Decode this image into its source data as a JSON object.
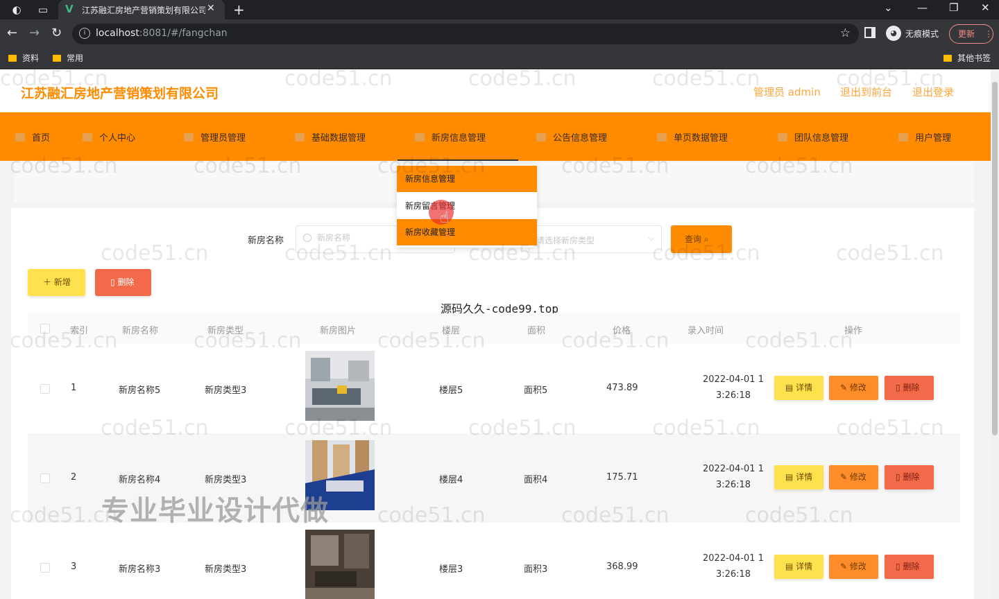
{
  "browser": {
    "tab_title": "江苏融汇房地产营销策划有限公司",
    "url_host": "localhost",
    "url_path": ":8081/#/fangchan",
    "incognito_label": "无痕模式",
    "update_label": "更新",
    "bookmarks": [
      "资料",
      "常用"
    ],
    "other_bookmarks": "其他书签"
  },
  "header": {
    "title": "江苏融汇房地产营销策划有限公司",
    "admin_label": "管理员 admin",
    "frontend_link": "退出到前台",
    "logout_link": "退出登录"
  },
  "nav": {
    "items": [
      {
        "label": "首页"
      },
      {
        "label": "个人中心"
      },
      {
        "label": "管理员管理"
      },
      {
        "label": "基础数据管理"
      },
      {
        "label": "新房信息管理"
      },
      {
        "label": "公告信息管理"
      },
      {
        "label": "单页数据管理"
      },
      {
        "label": "团队信息管理"
      },
      {
        "label": "用户管理"
      }
    ],
    "dropdown": [
      {
        "label": "新房信息管理"
      },
      {
        "label": "新房留言管理"
      },
      {
        "label": "新房收藏管理"
      }
    ]
  },
  "search": {
    "name_label": "新房名称",
    "name_placeholder": "新房名称",
    "type_placeholder": "请选择新房类型",
    "query_label": "查询"
  },
  "actions": {
    "add_label": "新增",
    "delete_label": "删除"
  },
  "overlay_text": "源码久久-code99.top",
  "banner_text": "专业毕业设计代做",
  "watermark_text": "code51.cn",
  "table": {
    "headers": {
      "index": "索引",
      "name": "新房名称",
      "type": "新房类型",
      "image": "新房图片",
      "floor": "楼层",
      "area": "面积",
      "price": "价格",
      "time": "录入时间",
      "ops": "操作"
    },
    "rows": [
      {
        "index": "1",
        "name": "新房名称5",
        "type": "新房类型3",
        "floor": "楼层5",
        "area": "面积5",
        "price": "473.89",
        "time_line1": "2022-04-01 1",
        "time_line2": "3:26:18"
      },
      {
        "index": "2",
        "name": "新房名称4",
        "type": "新房类型3",
        "floor": "楼层4",
        "area": "面积4",
        "price": "175.71",
        "time_line1": "2022-04-01 1",
        "time_line2": "3:26:18"
      },
      {
        "index": "3",
        "name": "新房名称3",
        "type": "新房类型3",
        "floor": "楼层3",
        "area": "面积3",
        "price": "368.99",
        "time_line1": "2022-04-01 1",
        "time_line2": "3:26:18"
      }
    ],
    "row_actions": {
      "detail": "详情",
      "edit": "修改",
      "delete": "删除"
    }
  },
  "colors": {
    "brand_orange": "#ff8c00",
    "yellow_button": "#ffe14d",
    "red_button": "#f26a4a"
  }
}
